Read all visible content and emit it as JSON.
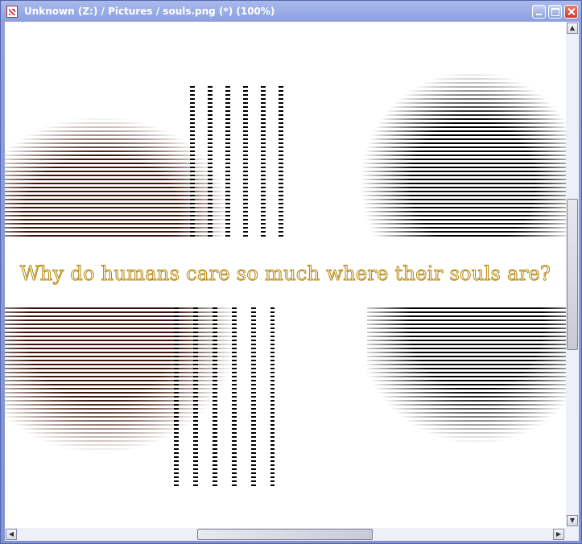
{
  "window": {
    "title": "Unknown (Z:) / Pictures / souls.png (*) (100%)",
    "buttons": {
      "minimize": "minimize",
      "maximize": "maximize",
      "close": "close"
    }
  },
  "image": {
    "caption": "Why do humans care so much where their souls are?"
  },
  "scrollbars": {
    "up_arrow": "▲",
    "down_arrow": "▼",
    "left_arrow": "◀",
    "right_arrow": "▶"
  },
  "colors": {
    "title_bar": "#8da0df",
    "caption_outline": "#b8870a",
    "image_background": "#ffffff"
  }
}
